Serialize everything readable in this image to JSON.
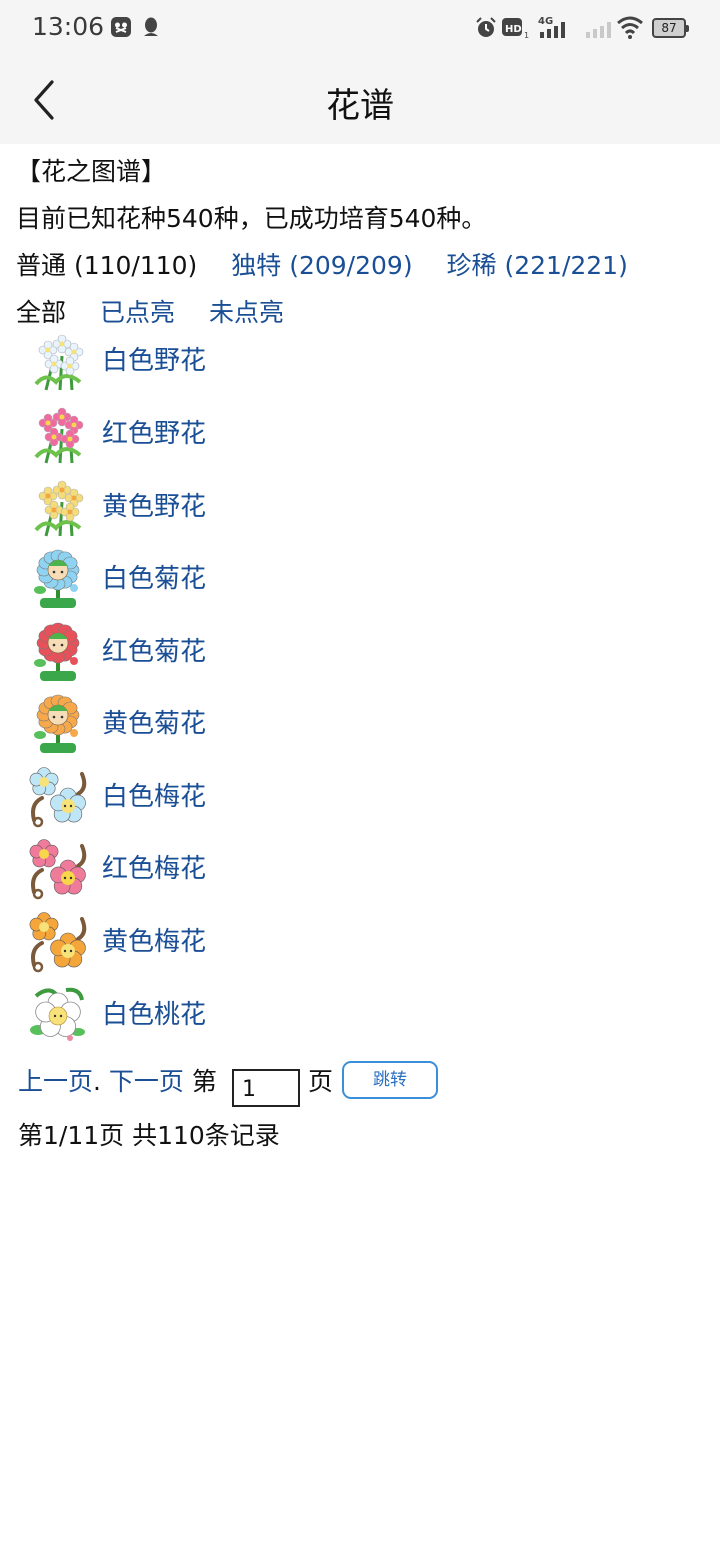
{
  "status_bar": {
    "time": "13:06",
    "battery": "87",
    "icons": [
      "screenshot-app-icon",
      "qq-icon",
      "alarm-icon",
      "hd-icon",
      "signal-4g-icon",
      "signal-empty-icon",
      "wifi-icon",
      "battery-icon"
    ]
  },
  "app_bar": {
    "title": "花谱",
    "back_icon": "back-chevron-icon"
  },
  "catalog": {
    "heading": "【花之图谱】",
    "summary": "目前已知花种540种，已成功培育540种。",
    "categories": [
      {
        "label": "普通 (110/110)",
        "active": true
      },
      {
        "label": "独特 (209/209)",
        "active": false
      },
      {
        "label": "珍稀 (221/221)",
        "active": false
      }
    ],
    "filters": [
      {
        "label": "全部",
        "active": true
      },
      {
        "label": "已点亮",
        "active": false
      },
      {
        "label": "未点亮",
        "active": false
      }
    ]
  },
  "flowers": [
    {
      "name": "白色野花",
      "petal": "#e8f4ff",
      "center": "#f7e27a",
      "kind": "wild"
    },
    {
      "name": "红色野花",
      "petal": "#f06aa0",
      "center": "#f7d64a",
      "kind": "wild"
    },
    {
      "name": "黄色野花",
      "petal": "#f5dc7a",
      "center": "#f3a640",
      "kind": "wild"
    },
    {
      "name": "白色菊花",
      "petal": "#8fd3f2",
      "center": "#4db34d",
      "kind": "mum"
    },
    {
      "name": "红色菊花",
      "petal": "#e8505a",
      "center": "#4db34d",
      "kind": "mum"
    },
    {
      "name": "黄色菊花",
      "petal": "#f7a84a",
      "center": "#4db34d",
      "kind": "mum"
    },
    {
      "name": "白色梅花",
      "petal": "#bfe6f7",
      "center": "#f7e27a",
      "kind": "plum"
    },
    {
      "name": "红色梅花",
      "petal": "#f07a9a",
      "center": "#f7d64a",
      "kind": "plum"
    },
    {
      "name": "黄色梅花",
      "petal": "#f5a63a",
      "center": "#f7e27a",
      "kind": "plum"
    },
    {
      "name": "白色桃花",
      "petal": "#ffffff",
      "center": "#f7e27a",
      "kind": "peach"
    }
  ],
  "pagination": {
    "prev": "上一页",
    "separator": ".",
    "next": "下一页",
    "page_prefix": "第",
    "page_value": "1",
    "page_suffix": "页",
    "jump": "跳转",
    "summary": "第1/11页 共110条记录"
  }
}
